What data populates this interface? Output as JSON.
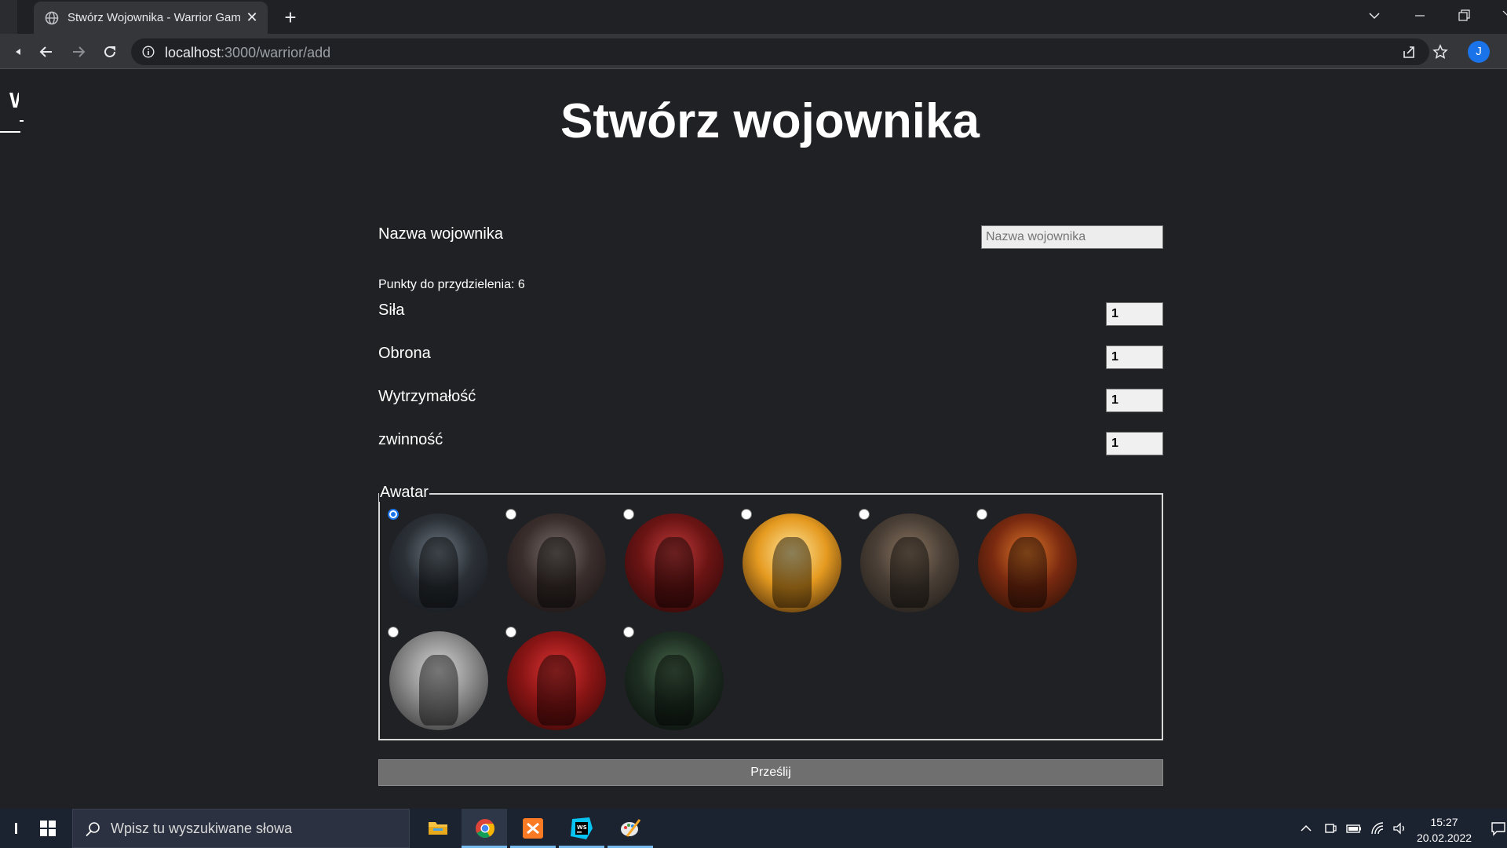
{
  "browser": {
    "tab_title": "Stwórz Wojownika - Warrior Game",
    "url_host": "localhost",
    "url_path": ":3000/warrior/add",
    "profile_initial": "J"
  },
  "page": {
    "corner_letter": "W",
    "title": "Stwórz wojownika",
    "name_label": "Nazwa wojownika",
    "name_placeholder": "Nazwa wojownika",
    "points_text": "Punkty do przydzielenia: 6",
    "stats": [
      {
        "label": "Siła",
        "value": "1"
      },
      {
        "label": "Obrona",
        "value": "1"
      },
      {
        "label": "Wytrzymałość",
        "value": "1"
      },
      {
        "label": "zwinność",
        "value": "1"
      }
    ],
    "avatar_legend": "Awatar",
    "avatars": [
      {
        "checked": true,
        "colors": [
          "#6e7a85",
          "#2b3036",
          "#11151a"
        ]
      },
      {
        "checked": false,
        "colors": [
          "#7a6f6c",
          "#3a2e2c",
          "#141010"
        ]
      },
      {
        "checked": false,
        "colors": [
          "#c23a3a",
          "#6b1414",
          "#240606"
        ]
      },
      {
        "checked": false,
        "colors": [
          "#ffe8a0",
          "#e59a20",
          "#2a1608"
        ]
      },
      {
        "checked": false,
        "colors": [
          "#8a7560",
          "#4a3f36",
          "#1a1714"
        ]
      },
      {
        "checked": false,
        "colors": [
          "#e0782a",
          "#7a2a10",
          "#1c0c06"
        ]
      },
      {
        "checked": false,
        "colors": [
          "#d8d8d8",
          "#8a8a8a",
          "#2a2a2a"
        ]
      },
      {
        "checked": false,
        "colors": [
          "#e03434",
          "#8a1515",
          "#2e0505"
        ]
      },
      {
        "checked": false,
        "colors": [
          "#48684c",
          "#1e2e22",
          "#060a08"
        ]
      }
    ],
    "submit_label": "Prześlij"
  },
  "taskbar": {
    "search_placeholder": "Wpisz tu wyszukiwane słowa",
    "time": "15:27",
    "date": "20.02.2022"
  }
}
